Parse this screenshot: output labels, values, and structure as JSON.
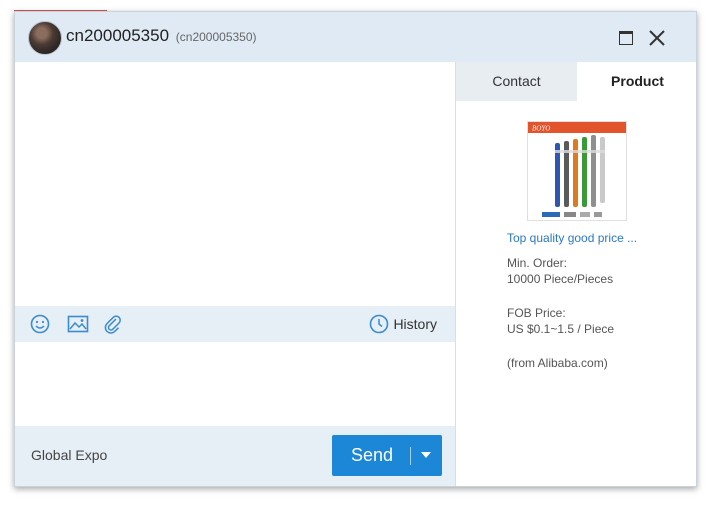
{
  "header": {
    "username": "cn200005350",
    "username_sub": "(cn200005350)"
  },
  "toolbar": {
    "emoji_icon": "smiley-icon",
    "image_icon": "image-icon",
    "attach_icon": "paperclip-icon",
    "history_label": "History"
  },
  "footer": {
    "expo_label": "Global Expo",
    "send_label": "Send"
  },
  "side": {
    "tabs": [
      {
        "label": "Contact",
        "active": false
      },
      {
        "label": "Product",
        "active": true
      }
    ],
    "product": {
      "image_brand": "BOYO",
      "title": "Top quality good price ...",
      "min_order_label": "Min. Order:",
      "min_order_value": "10000 Piece/Pieces",
      "fob_label": "FOB Price:",
      "fob_value": "US $0.1~1.5 / Piece",
      "source": "(from Alibaba.com)"
    }
  },
  "colors": {
    "accent": "#1b87d6",
    "header_bg": "#dfeaf4",
    "toolbar_bg": "#e6eef6",
    "link": "#2b78c4"
  }
}
